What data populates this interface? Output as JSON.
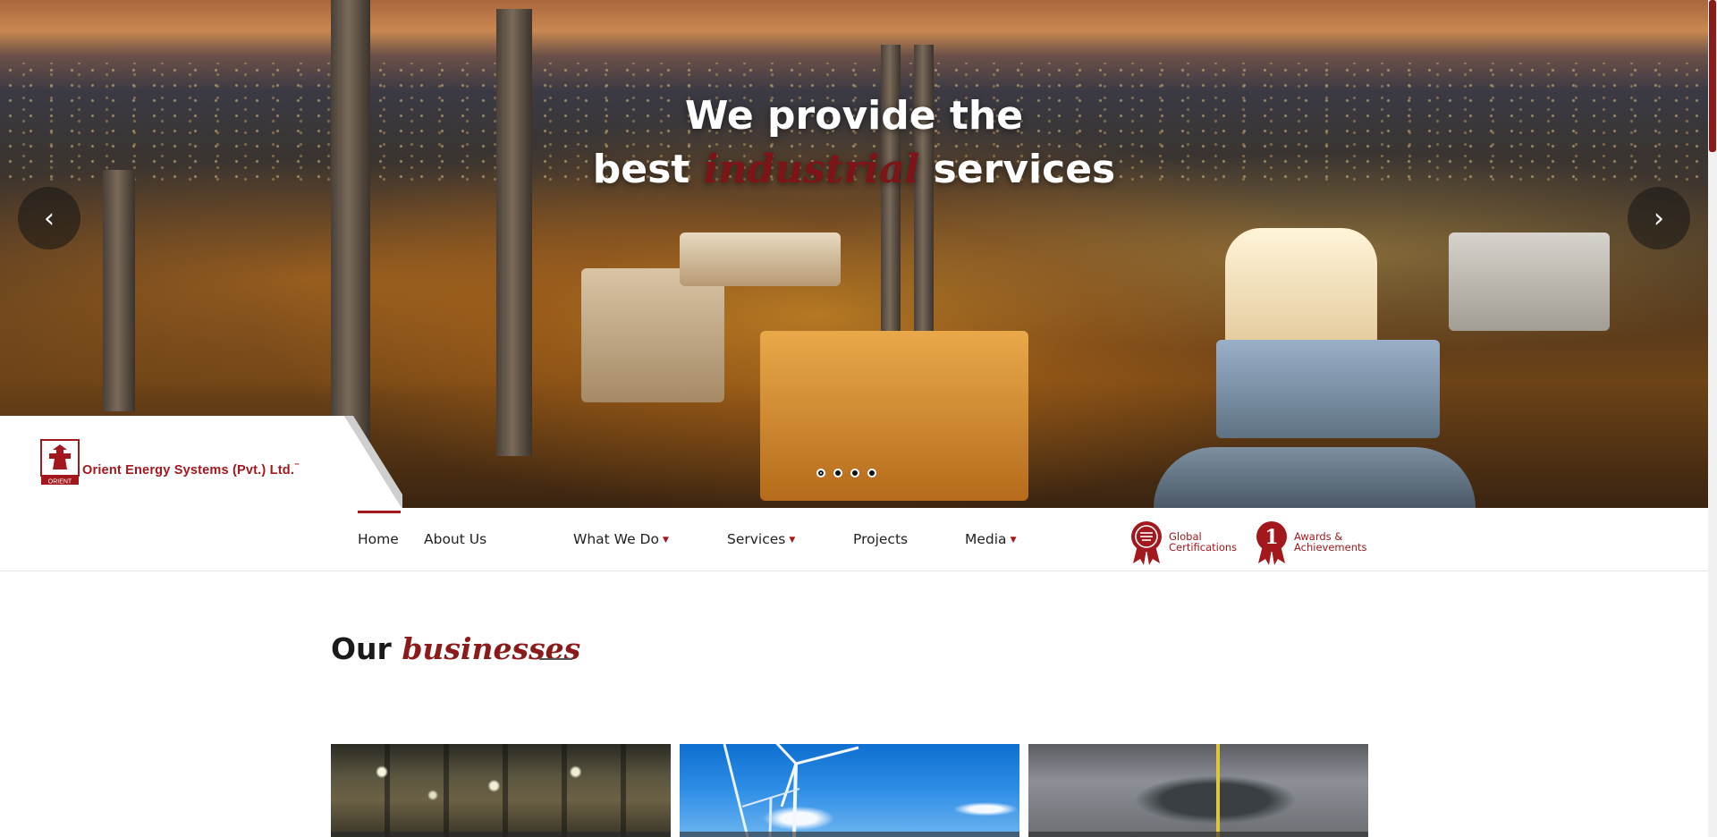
{
  "hero": {
    "title_line1": "We provide the",
    "title_line2_pre": "best",
    "title_line2_accent": "industrial",
    "title_line2_post": "services",
    "prev_label": "‹",
    "next_label": "›",
    "slide_count": 4,
    "active_slide": 1
  },
  "logo": {
    "company_name": "Orient Energy Systems (Pvt.) Ltd.",
    "trademark": "™",
    "mark_text": "ORIENT"
  },
  "nav": {
    "items": [
      {
        "label": "Home",
        "active": true,
        "has_dropdown": false
      },
      {
        "label": "About Us",
        "active": false,
        "has_dropdown": false
      },
      {
        "label": "What We Do",
        "active": false,
        "has_dropdown": true
      },
      {
        "label": "Services",
        "active": false,
        "has_dropdown": true
      },
      {
        "label": "Projects",
        "active": false,
        "has_dropdown": false
      },
      {
        "label": "Media",
        "active": false,
        "has_dropdown": true
      }
    ],
    "caret": "▼"
  },
  "badges": [
    {
      "line1": "Global",
      "line2": "Certifications",
      "icon": "certificate-ribbon-icon"
    },
    {
      "line1": "Awards &",
      "line2": "Achievements",
      "icon": "award-ribbon-icon",
      "number": "1"
    }
  ],
  "section": {
    "title_pre": "Our",
    "title_accent": "businesses"
  },
  "cards": [
    {
      "name": "business-card-power-plant"
    },
    {
      "name": "business-card-renewable-energy"
    },
    {
      "name": "business-card-industrial-equipment"
    }
  ],
  "colors": {
    "brand_red": "#a3181d",
    "accent_dark_red": "#7c1418",
    "text_dark": "#222222"
  }
}
